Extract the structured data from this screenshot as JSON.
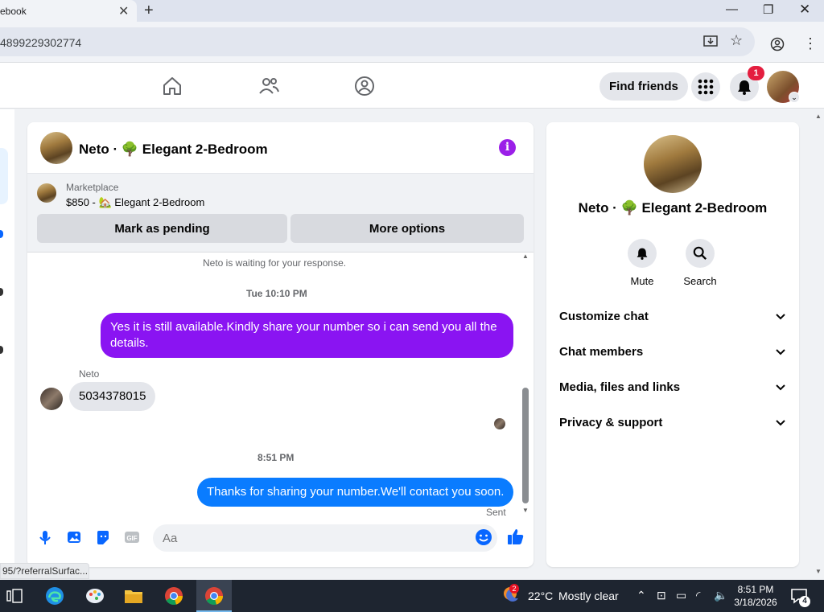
{
  "browser": {
    "tab_title": "ebook",
    "url": "4899229302774"
  },
  "nav": {
    "find_friends": "Find friends",
    "notification_count": "1"
  },
  "chat": {
    "title": "Neto · 🌳 Elegant 2-Bedroom",
    "marketplace_label": "Marketplace",
    "listing": "$850 - 🏡 Elegant 2-Bedroom",
    "mark_pending": "Mark as pending",
    "more_options": "More options",
    "messages": {
      "waiting": "Neto is waiting for your response.",
      "timestamp1": "Tue 10:10 PM",
      "out1": "Yes it is still available.Kindly share your number so i can send you all the details.",
      "sender_name": "Neto",
      "in1": "5034378015",
      "timestamp2": "8:51 PM",
      "out2": "Thanks for sharing your number.We'll contact you soon.",
      "sent_status": "Sent"
    },
    "input_placeholder": "Aa"
  },
  "info_panel": {
    "title": "Neto · 🌳 Elegant 2-Bedroom",
    "mute": "Mute",
    "search": "Search",
    "sections": [
      "Customize chat",
      "Chat members",
      "Media, files and links",
      "Privacy & support"
    ]
  },
  "status_url": "95/?referralSurfac...",
  "taskbar": {
    "weather_temp": "22°C",
    "weather_desc": "Mostly clear",
    "time": "8:51 PM",
    "date": "3/18/2026",
    "notif_count": "4",
    "edge_badge": "2"
  },
  "colors": {
    "purple_bubble": "#8a14f2",
    "blue_bubble": "#0a7cff",
    "fb_blue": "#0866ff"
  }
}
